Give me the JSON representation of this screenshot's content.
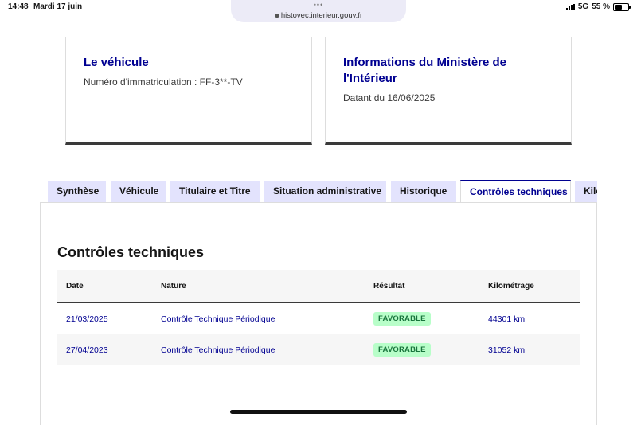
{
  "status_bar": {
    "time": "14:48",
    "date": "Mardi 17 juin",
    "dots": "•••",
    "url": "histovec.interieur.gouv.fr",
    "network": "5G",
    "battery": "55 %",
    "battery_level_percent": 55
  },
  "cards": {
    "vehicle": {
      "title": "Le véhicule",
      "text": "Numéro d'immatriculation : FF-3**-TV"
    },
    "ministry": {
      "title": "Informations du Ministère de l'Intérieur",
      "text": "Datant du 16/06/2025"
    }
  },
  "tabs": [
    {
      "label": "Synthèse",
      "active": false
    },
    {
      "label": "Véhicule",
      "active": false
    },
    {
      "label": "Titulaire et Titre",
      "active": false
    },
    {
      "label": "Situation administrative",
      "active": false
    },
    {
      "label": "Historique",
      "active": false
    },
    {
      "label": "Contrôles techniques",
      "active": true
    },
    {
      "label": "Kilométrage",
      "active": false
    }
  ],
  "section": {
    "title": "Contrôles techniques",
    "columns": [
      "Date",
      "Nature",
      "Résultat",
      "Kilométrage"
    ],
    "rows": [
      {
        "date": "21/03/2025",
        "nature": "Contrôle Technique Périodique",
        "result": "FAVORABLE",
        "km": "44301 km"
      },
      {
        "date": "27/04/2023",
        "nature": "Contrôle Technique Périodique",
        "result": "FAVORABLE",
        "km": "31052 km"
      }
    ]
  },
  "colors": {
    "primary": "#000091",
    "tab_bg": "#e3e3fd",
    "badge_bg": "#b8fec9",
    "badge_text": "#18753c"
  }
}
